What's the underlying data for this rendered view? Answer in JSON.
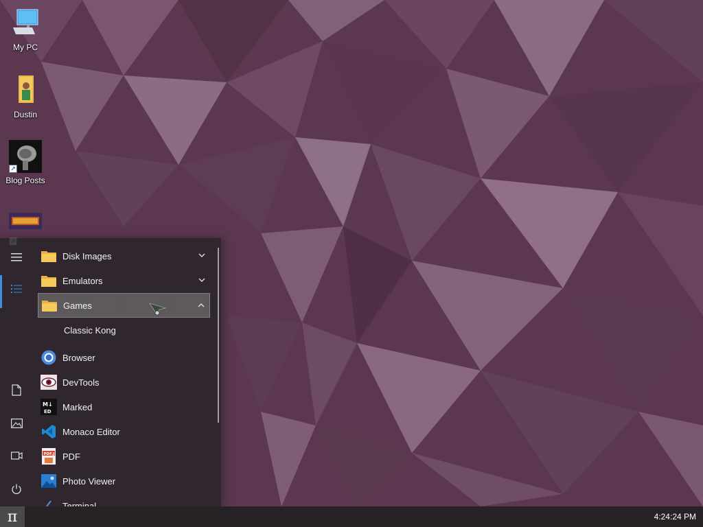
{
  "desktop": {
    "icons": [
      {
        "label": "My PC",
        "icon": "computer-icon"
      },
      {
        "label": "Dustin",
        "icon": "user-folder-icon"
      },
      {
        "label": "Blog Posts",
        "icon": "brain-shortcut-icon"
      },
      {
        "label": "",
        "icon": "doom-shortcut-icon"
      }
    ]
  },
  "start_menu": {
    "rail": [
      {
        "icon": "hamburger-icon"
      },
      {
        "icon": "all-apps-list-icon",
        "active": true
      },
      {
        "icon": "documents-icon"
      },
      {
        "icon": "pictures-icon"
      },
      {
        "icon": "videos-icon"
      },
      {
        "icon": "power-icon"
      }
    ],
    "items": [
      {
        "label": "Disk Images",
        "icon": "folder-icon",
        "expanded": false
      },
      {
        "label": "Emulators",
        "icon": "folder-icon",
        "expanded": false
      },
      {
        "label": "Games",
        "icon": "folder-icon",
        "expanded": true,
        "selected": true
      },
      {
        "label": "Classic Kong",
        "sub": true
      },
      {
        "label": "Browser",
        "icon": "browser-icon"
      },
      {
        "label": "DevTools",
        "icon": "devtools-icon"
      },
      {
        "label": "Marked",
        "icon": "markdown-icon"
      },
      {
        "label": "Monaco Editor",
        "icon": "vscode-icon"
      },
      {
        "label": "PDF",
        "icon": "pdf-icon"
      },
      {
        "label": "Photo Viewer",
        "icon": "photo-icon"
      },
      {
        "label": "Terminal",
        "icon": "terminal-icon"
      }
    ]
  },
  "taskbar": {
    "start_symbol": "π",
    "clock": "4:24:24 PM"
  },
  "colors": {
    "wallpaper": "#5b3850",
    "accent": "#3f8de0",
    "taskbar": "#262226"
  }
}
